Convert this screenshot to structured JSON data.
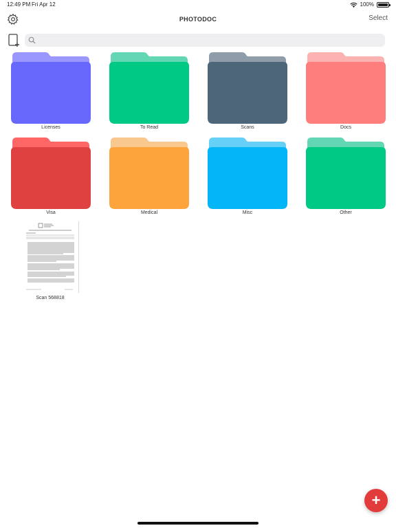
{
  "status_bar": {
    "time": "12:49 PM",
    "date": "Fri Apr 12",
    "battery": "100%"
  },
  "nav": {
    "title": "PHOTODOC",
    "select_label": "Select"
  },
  "search": {
    "placeholder": ""
  },
  "folders": [
    {
      "label": "Licenses",
      "back": "#9a97ff",
      "front": "#6868fd"
    },
    {
      "label": "To Read",
      "back": "#63d7b4",
      "front": "#00c985"
    },
    {
      "label": "Scans",
      "back": "#8f9ca9",
      "front": "#4e6679"
    },
    {
      "label": "Docs",
      "back": "#fdb2b2",
      "front": "#fe7e7e"
    },
    {
      "label": "Visa",
      "back": "#ff6767",
      "front": "#df4040"
    },
    {
      "label": "Medical",
      "back": "#f8c88e",
      "front": "#fea43c"
    },
    {
      "label": "Misc",
      "back": "#67d0f6",
      "front": "#05b6f7"
    },
    {
      "label": "Other",
      "back": "#63d7b4",
      "front": "#00c985"
    }
  ],
  "documents": [
    {
      "label": "Scan 568818"
    }
  ],
  "fab": {
    "label": "+",
    "color": "#e23b3b"
  }
}
